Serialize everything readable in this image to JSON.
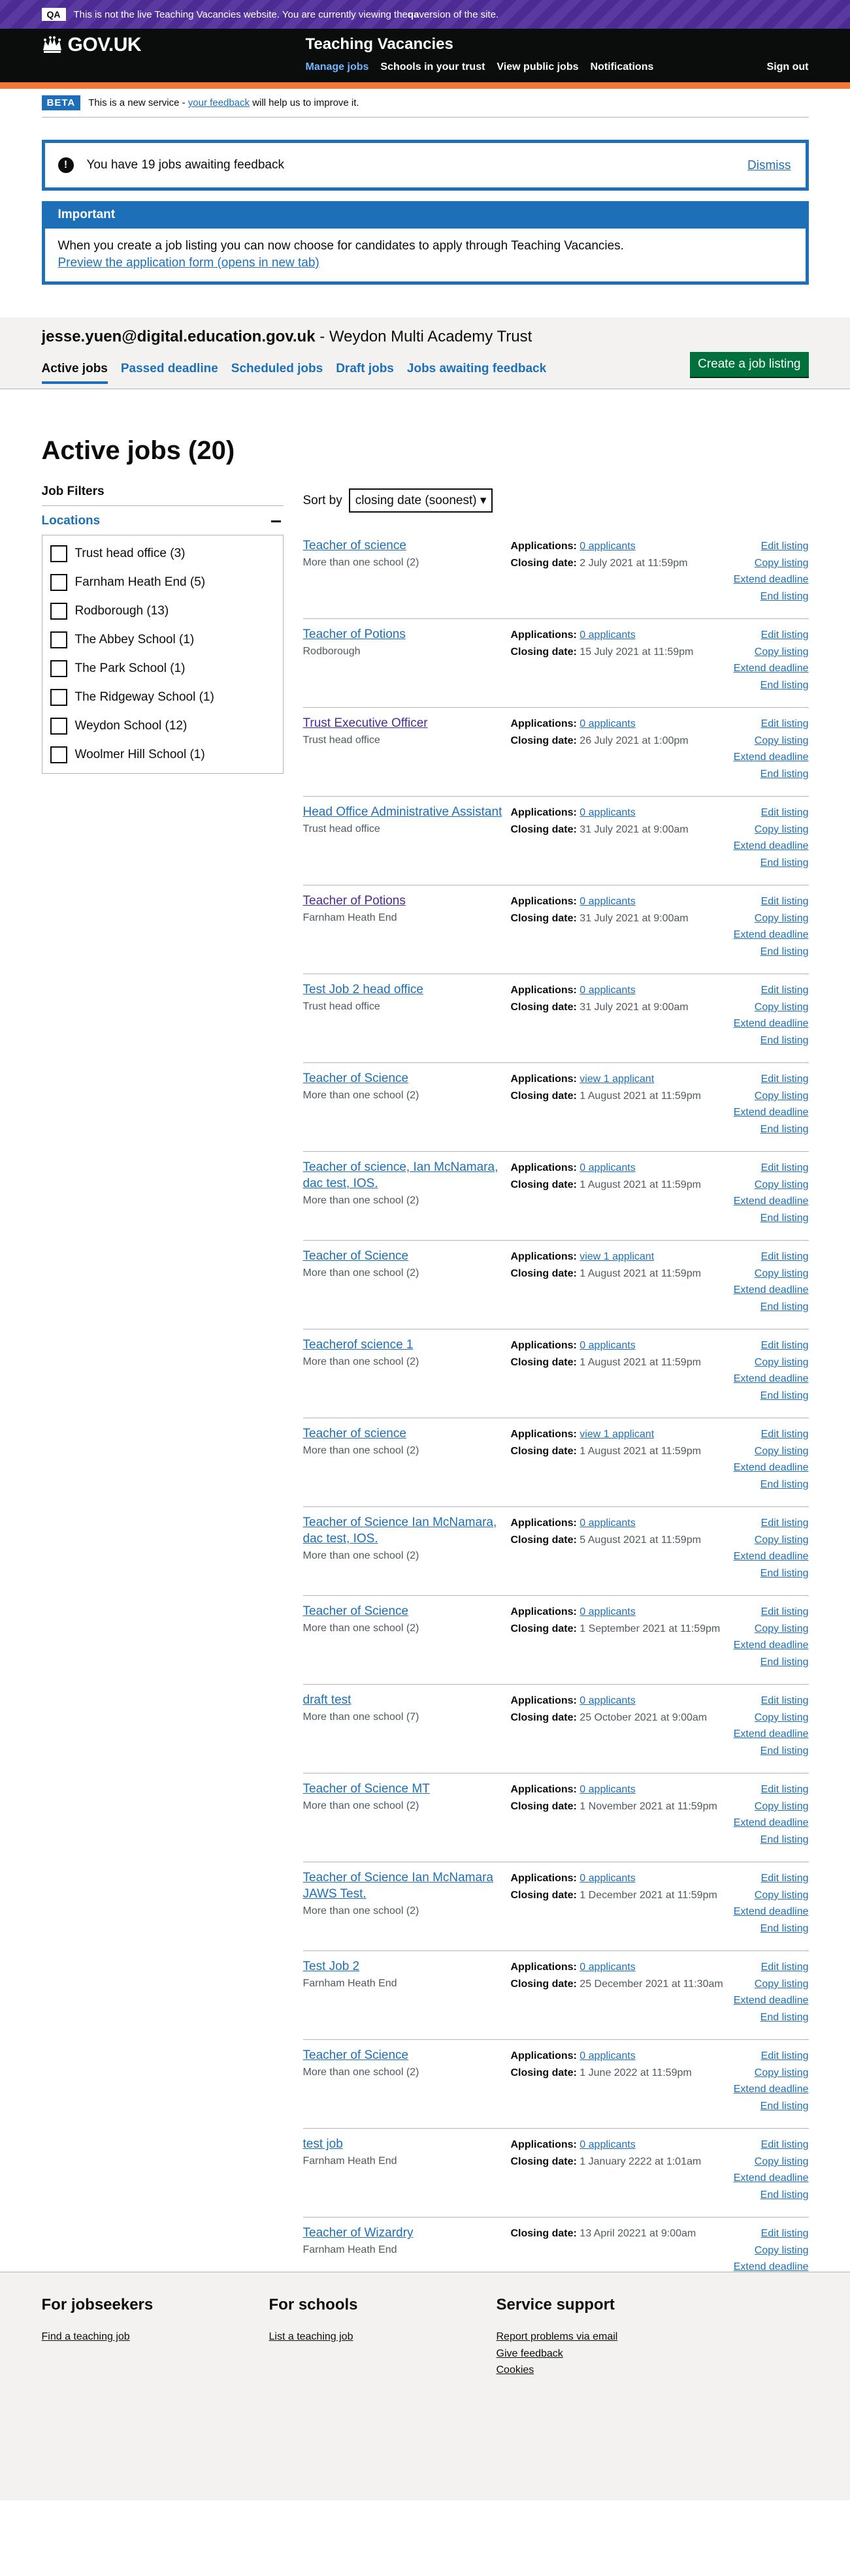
{
  "qa_banner": {
    "tag": "QA",
    "text_before": "This is not the live Teaching Vacancies website. You are currently viewing the ",
    "text_bold": "qa",
    "text_after": " version of the site."
  },
  "header": {
    "logo_text": "GOV.UK",
    "service_name": "Teaching Vacancies",
    "nav": [
      "Manage jobs",
      "Schools in your trust",
      "View public jobs",
      "Notifications"
    ],
    "sign_out": "Sign out"
  },
  "phase_banner": {
    "tag": "BETA",
    "text_before": "This is a new service - ",
    "link": "your feedback",
    "text_after": " will help us to improve it."
  },
  "notification": {
    "icon": "!",
    "text": "You have 19 jobs awaiting feedback",
    "dismiss": "Dismiss"
  },
  "important": {
    "title": "Important",
    "body": "When you create a job listing you can now choose for candidates to apply through Teaching Vacancies.",
    "link": "Preview the application form (opens in new tab)"
  },
  "account": {
    "email": "jesse.yuen@digital.education.gov.uk",
    "org": " - Weydon Multi Academy Trust"
  },
  "tabs": [
    "Active jobs",
    "Passed deadline",
    "Scheduled jobs",
    "Draft jobs",
    "Jobs awaiting feedback"
  ],
  "create_button": "Create a job listing",
  "page_title": "Active jobs (20)",
  "filters": {
    "title": "Job Filters",
    "locations_label": "Locations",
    "locations": [
      "Trust head office (3)",
      "Farnham Heath End (5)",
      "Rodborough (13)",
      "The Abbey School (1)",
      "The Park School (1)",
      "The Ridgeway School (1)",
      "Weydon School (12)",
      "Woolmer Hill School (1)"
    ]
  },
  "sort": {
    "label": "Sort by",
    "selected": "closing date (soonest)"
  },
  "labels": {
    "applications": "Applications:",
    "closing": "Closing date:"
  },
  "actions": [
    "Edit listing",
    "Copy listing",
    "Extend deadline",
    "End listing"
  ],
  "jobs": [
    {
      "title": "Teacher of science",
      "location": "More than one school (2)",
      "applications": "0 applicants",
      "closing": "2 July 2021 at 11:59pm"
    },
    {
      "title": "Teacher of Potions",
      "location": "Rodborough",
      "applications": "0 applicants",
      "closing": "15 July 2021 at 11:59pm"
    },
    {
      "title": "Trust Executive Officer",
      "location": "Trust head office",
      "applications": "0 applicants",
      "closing": "26 July 2021 at 1:00pm"
    },
    {
      "title": "Head Office Administrative Assistant",
      "location": "Trust head office",
      "applications": "0 applicants",
      "closing": "31 July 2021 at 9:00am"
    },
    {
      "title": "Teacher of Potions",
      "location": "Farnham Heath End",
      "applications": "0 applicants",
      "closing": "31 July 2021 at 9:00am"
    },
    {
      "title": "Test Job 2 head office",
      "location": "Trust head office",
      "applications": "0 applicants",
      "closing": "31 July 2021 at 9:00am"
    },
    {
      "title": "Teacher of Science",
      "location": "More than one school (2)",
      "applications": "view 1 applicant",
      "closing": "1 August 2021 at 11:59pm"
    },
    {
      "title": "Teacher of science, Ian McNamara, dac test, IOS.",
      "location": "More than one school (2)",
      "applications": "0 applicants",
      "closing": "1 August 2021 at 11:59pm"
    },
    {
      "title": "Teacher of Science",
      "location": "More than one school (2)",
      "applications": "view 1 applicant",
      "closing": "1 August 2021 at 11:59pm"
    },
    {
      "title": "Teacherof science 1",
      "location": "More than one school (2)",
      "applications": "0 applicants",
      "closing": "1 August 2021 at 11:59pm"
    },
    {
      "title": "Teacher of science",
      "location": "More than one school (2)",
      "applications": "view 1 applicant",
      "closing": "1 August 2021 at 11:59pm"
    },
    {
      "title": "Teacher of Science Ian McNamara, dac test, IOS.",
      "location": "More than one school (2)",
      "applications": "0 applicants",
      "closing": "5 August 2021 at 11:59pm"
    },
    {
      "title": "Teacher of Science",
      "location": "More than one school (2)",
      "applications": "0 applicants",
      "closing": "1 September 2021 at 11:59pm"
    },
    {
      "title": "draft test",
      "location": "More than one school (7)",
      "applications": "0 applicants",
      "closing": "25 October 2021 at 9:00am"
    },
    {
      "title": "Teacher of Science MT",
      "location": "More than one school (2)",
      "applications": "0 applicants",
      "closing": "1 November 2021 at 11:59pm"
    },
    {
      "title": "Teacher of Science Ian McNamara JAWS Test.",
      "location": "More than one school (2)",
      "applications": "0 applicants",
      "closing": "1 December 2021 at 11:59pm"
    },
    {
      "title": "Test Job 2",
      "location": "Farnham Heath End",
      "applications": "0 applicants",
      "closing": "25 December 2021 at 11:30am"
    },
    {
      "title": "Teacher of Science",
      "location": "More than one school (2)",
      "applications": "0 applicants",
      "closing": "1 June 2022 at 11:59pm"
    },
    {
      "title": "test job",
      "location": "Farnham Heath End",
      "applications": "0 applicants",
      "closing": "1 January 2222 at 1:01am"
    },
    {
      "title": "Teacher of Wizardry",
      "location": "Farnham Heath End",
      "applications": "",
      "closing": "13 April 20221 at 9:00am"
    }
  ],
  "footer": {
    "columns": [
      {
        "heading": "For jobseekers",
        "links": [
          "Find a teaching job"
        ]
      },
      {
        "heading": "For schools",
        "links": [
          "List a teaching job"
        ]
      },
      {
        "heading": "Service support",
        "links": [
          "Report problems via email",
          "Give feedback",
          "Cookies"
        ]
      }
    ]
  }
}
